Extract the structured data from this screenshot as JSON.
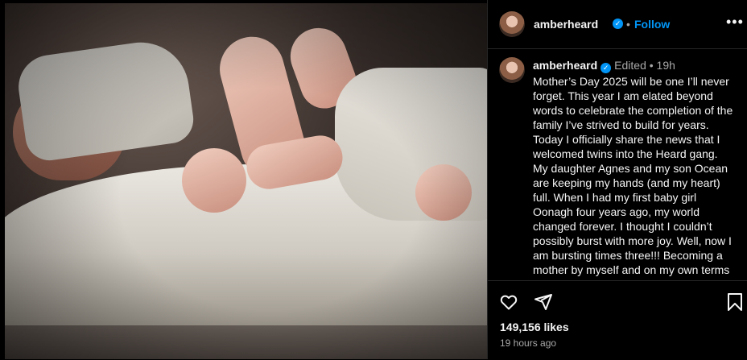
{
  "post": {
    "username": "amberheard",
    "verified_icon": "verified-badge-icon",
    "follow_label": "Follow",
    "separator": "•",
    "more_label": "•••"
  },
  "caption": {
    "username": "amberheard",
    "edited": "Edited",
    "separator": "•",
    "time_ago": "19h",
    "text": "Mother’s Day 2025 will be one I’ll never forget. This year I am elated beyond words to celebrate the completion of the family I’ve strived to build for years. Today I officially share the news that I welcomed twins into the Heard gang. My daughter Agnes and my son Ocean are keeping my hands (and my heart) full. When I had my first baby girl Oonagh four years ago, my world changed forever. I thought I couldn’t possibly burst with more joy. Well, now I am bursting times three!!! Becoming a mother by myself and on my own terms despite my own fertility challenges has"
  },
  "actions": {
    "like_icon": "heart-icon",
    "share_icon": "paper-plane-icon",
    "save_icon": "bookmark-icon",
    "likes": "149,156 likes",
    "posted": "19 hours ago"
  },
  "colors": {
    "accent": "#0095f6",
    "background": "#000000",
    "secondary_text": "#a8a8a8"
  }
}
